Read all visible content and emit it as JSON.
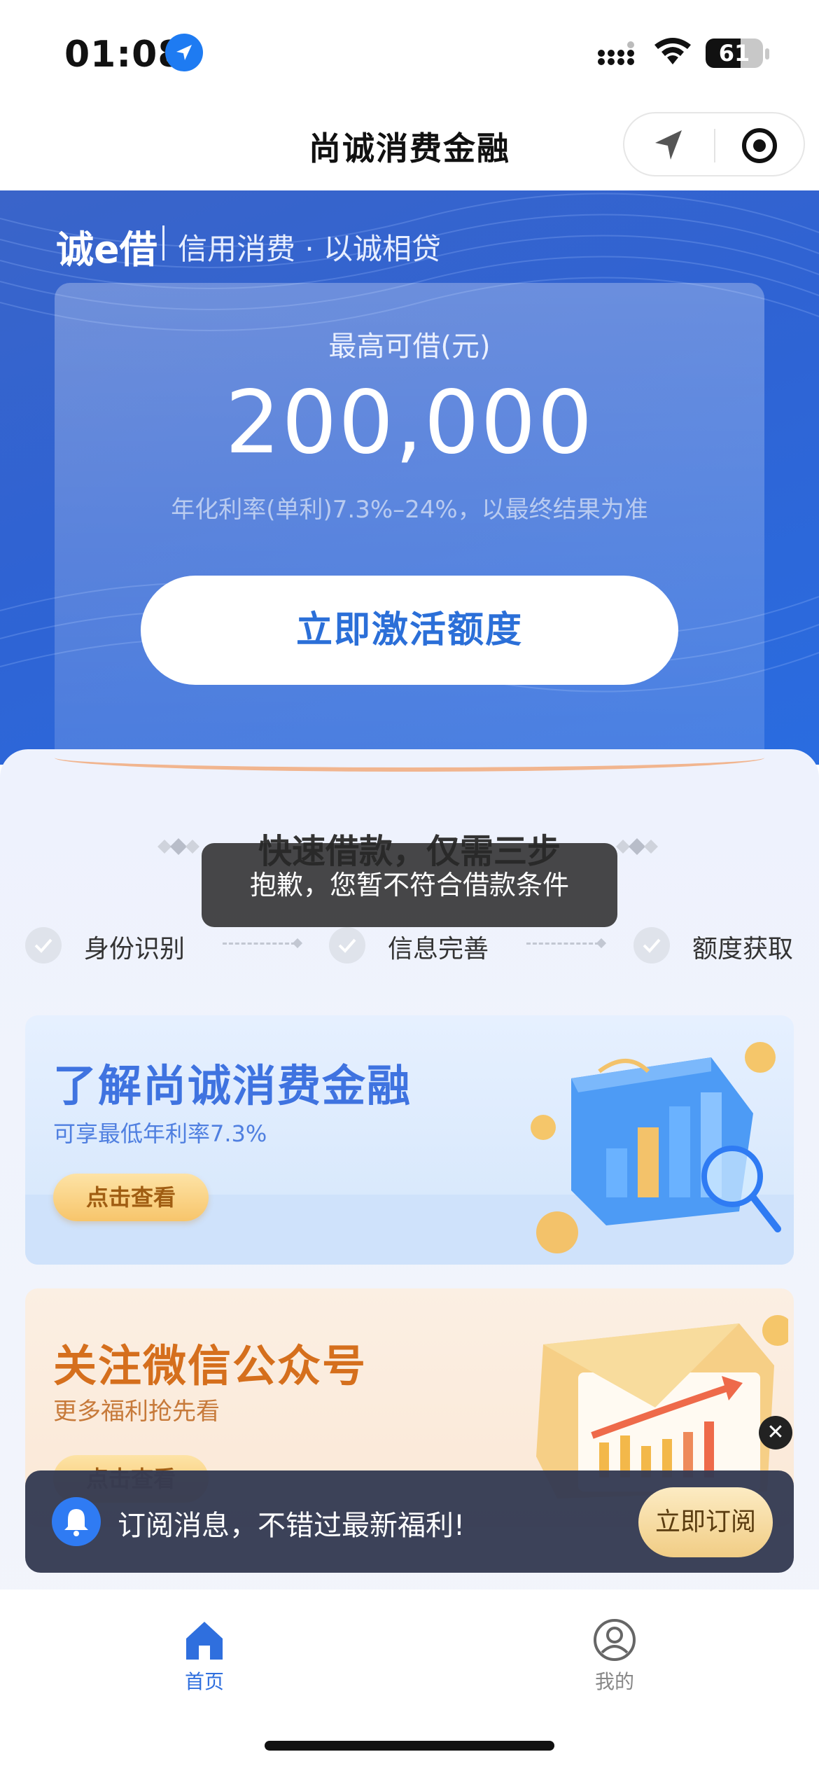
{
  "status": {
    "time": "01:08",
    "battery": "61",
    "battery_level": 0.61
  },
  "nav": {
    "title": "尚诚消费金融"
  },
  "hero": {
    "brand": "诚e借",
    "slogan": "信用消费 · 以诚相贷",
    "card_label": "最高可借(元)",
    "amount": "200,000",
    "rate_note": "年化利率(单利)7.3%–24%，以最终结果为准",
    "activate_label": "立即激活额度"
  },
  "steps": {
    "title": "快速借款，仅需三步",
    "items": [
      {
        "label": "身份识别"
      },
      {
        "label": "信息完善"
      },
      {
        "label": "额度获取"
      }
    ]
  },
  "toast": {
    "text": "抱歉，您暂不符合借款条件"
  },
  "promo1": {
    "title": "了解尚诚消费金融",
    "subtitle": "可享最低年利率7.3%",
    "button": "点击查看"
  },
  "promo2": {
    "title": "关注微信公众号",
    "subtitle": "更多福利抢先看",
    "button": "点击查看"
  },
  "subscribe": {
    "text": "订阅消息，不错过最新福利!",
    "button": "立即订阅",
    "close": "✕"
  },
  "tabs": [
    {
      "label": "首页",
      "icon": "home-icon",
      "active": true
    },
    {
      "label": "我的",
      "icon": "profile-icon",
      "active": false
    }
  ],
  "colors": {
    "primary": "#2f6fde",
    "active_tab": "#2f6fde",
    "inactive_tab": "#888888",
    "accent_orange": "#d56f1d"
  }
}
